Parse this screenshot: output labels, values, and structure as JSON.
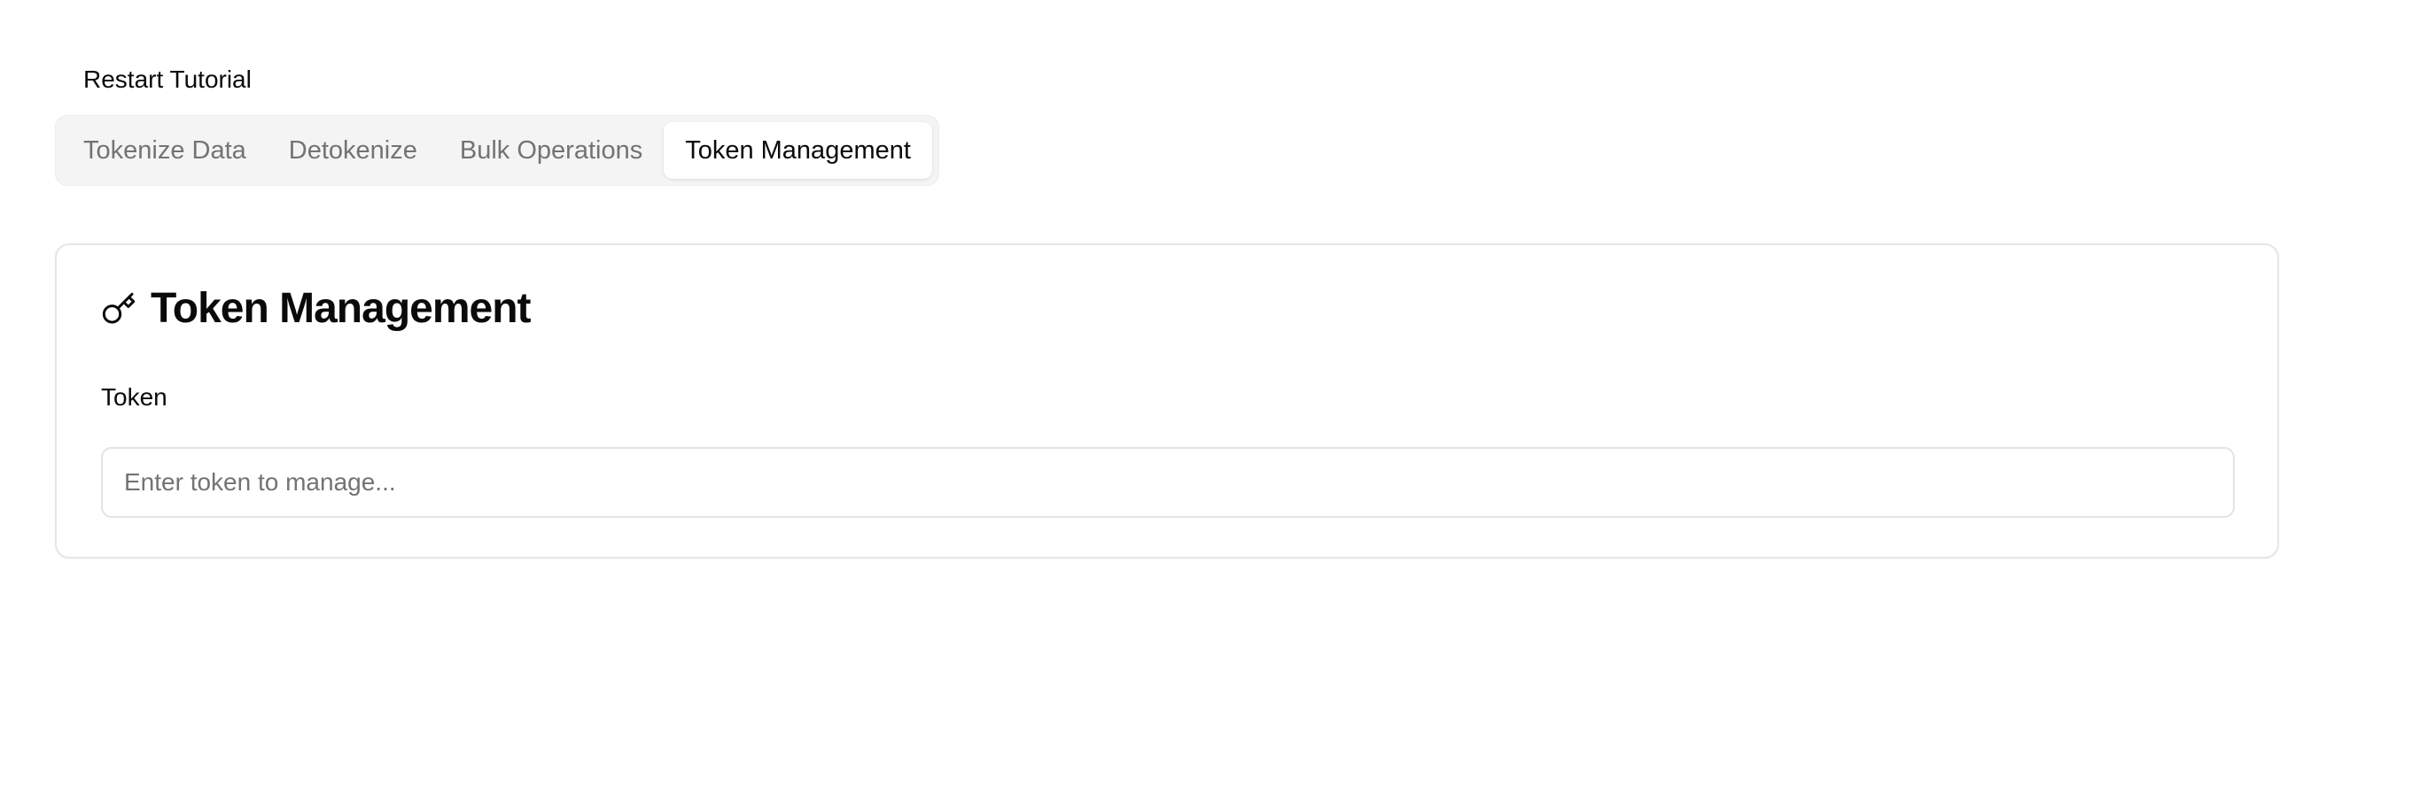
{
  "header": {
    "restart_label": "Restart Tutorial"
  },
  "tabs": [
    {
      "label": "Tokenize Data",
      "active": false
    },
    {
      "label": "Detokenize",
      "active": false
    },
    {
      "label": "Bulk Operations",
      "active": false
    },
    {
      "label": "Token Management",
      "active": true
    }
  ],
  "card": {
    "icon": "key-icon",
    "title": "Token Management",
    "field_label": "Token",
    "input_value": "",
    "input_placeholder": "Enter token to manage..."
  }
}
